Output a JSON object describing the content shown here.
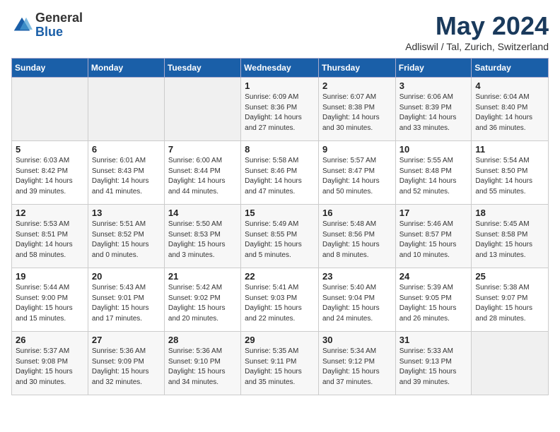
{
  "header": {
    "logo_general": "General",
    "logo_blue": "Blue",
    "title": "May 2024",
    "subtitle": "Adliswil / Tal, Zurich, Switzerland"
  },
  "weekdays": [
    "Sunday",
    "Monday",
    "Tuesday",
    "Wednesday",
    "Thursday",
    "Friday",
    "Saturday"
  ],
  "weeks": [
    [
      {
        "day": "",
        "info": ""
      },
      {
        "day": "",
        "info": ""
      },
      {
        "day": "",
        "info": ""
      },
      {
        "day": "1",
        "info": "Sunrise: 6:09 AM\nSunset: 8:36 PM\nDaylight: 14 hours\nand 27 minutes."
      },
      {
        "day": "2",
        "info": "Sunrise: 6:07 AM\nSunset: 8:38 PM\nDaylight: 14 hours\nand 30 minutes."
      },
      {
        "day": "3",
        "info": "Sunrise: 6:06 AM\nSunset: 8:39 PM\nDaylight: 14 hours\nand 33 minutes."
      },
      {
        "day": "4",
        "info": "Sunrise: 6:04 AM\nSunset: 8:40 PM\nDaylight: 14 hours\nand 36 minutes."
      }
    ],
    [
      {
        "day": "5",
        "info": "Sunrise: 6:03 AM\nSunset: 8:42 PM\nDaylight: 14 hours\nand 39 minutes."
      },
      {
        "day": "6",
        "info": "Sunrise: 6:01 AM\nSunset: 8:43 PM\nDaylight: 14 hours\nand 41 minutes."
      },
      {
        "day": "7",
        "info": "Sunrise: 6:00 AM\nSunset: 8:44 PM\nDaylight: 14 hours\nand 44 minutes."
      },
      {
        "day": "8",
        "info": "Sunrise: 5:58 AM\nSunset: 8:46 PM\nDaylight: 14 hours\nand 47 minutes."
      },
      {
        "day": "9",
        "info": "Sunrise: 5:57 AM\nSunset: 8:47 PM\nDaylight: 14 hours\nand 50 minutes."
      },
      {
        "day": "10",
        "info": "Sunrise: 5:55 AM\nSunset: 8:48 PM\nDaylight: 14 hours\nand 52 minutes."
      },
      {
        "day": "11",
        "info": "Sunrise: 5:54 AM\nSunset: 8:50 PM\nDaylight: 14 hours\nand 55 minutes."
      }
    ],
    [
      {
        "day": "12",
        "info": "Sunrise: 5:53 AM\nSunset: 8:51 PM\nDaylight: 14 hours\nand 58 minutes."
      },
      {
        "day": "13",
        "info": "Sunrise: 5:51 AM\nSunset: 8:52 PM\nDaylight: 15 hours\nand 0 minutes."
      },
      {
        "day": "14",
        "info": "Sunrise: 5:50 AM\nSunset: 8:53 PM\nDaylight: 15 hours\nand 3 minutes."
      },
      {
        "day": "15",
        "info": "Sunrise: 5:49 AM\nSunset: 8:55 PM\nDaylight: 15 hours\nand 5 minutes."
      },
      {
        "day": "16",
        "info": "Sunrise: 5:48 AM\nSunset: 8:56 PM\nDaylight: 15 hours\nand 8 minutes."
      },
      {
        "day": "17",
        "info": "Sunrise: 5:46 AM\nSunset: 8:57 PM\nDaylight: 15 hours\nand 10 minutes."
      },
      {
        "day": "18",
        "info": "Sunrise: 5:45 AM\nSunset: 8:58 PM\nDaylight: 15 hours\nand 13 minutes."
      }
    ],
    [
      {
        "day": "19",
        "info": "Sunrise: 5:44 AM\nSunset: 9:00 PM\nDaylight: 15 hours\nand 15 minutes."
      },
      {
        "day": "20",
        "info": "Sunrise: 5:43 AM\nSunset: 9:01 PM\nDaylight: 15 hours\nand 17 minutes."
      },
      {
        "day": "21",
        "info": "Sunrise: 5:42 AM\nSunset: 9:02 PM\nDaylight: 15 hours\nand 20 minutes."
      },
      {
        "day": "22",
        "info": "Sunrise: 5:41 AM\nSunset: 9:03 PM\nDaylight: 15 hours\nand 22 minutes."
      },
      {
        "day": "23",
        "info": "Sunrise: 5:40 AM\nSunset: 9:04 PM\nDaylight: 15 hours\nand 24 minutes."
      },
      {
        "day": "24",
        "info": "Sunrise: 5:39 AM\nSunset: 9:05 PM\nDaylight: 15 hours\nand 26 minutes."
      },
      {
        "day": "25",
        "info": "Sunrise: 5:38 AM\nSunset: 9:07 PM\nDaylight: 15 hours\nand 28 minutes."
      }
    ],
    [
      {
        "day": "26",
        "info": "Sunrise: 5:37 AM\nSunset: 9:08 PM\nDaylight: 15 hours\nand 30 minutes."
      },
      {
        "day": "27",
        "info": "Sunrise: 5:36 AM\nSunset: 9:09 PM\nDaylight: 15 hours\nand 32 minutes."
      },
      {
        "day": "28",
        "info": "Sunrise: 5:36 AM\nSunset: 9:10 PM\nDaylight: 15 hours\nand 34 minutes."
      },
      {
        "day": "29",
        "info": "Sunrise: 5:35 AM\nSunset: 9:11 PM\nDaylight: 15 hours\nand 35 minutes."
      },
      {
        "day": "30",
        "info": "Sunrise: 5:34 AM\nSunset: 9:12 PM\nDaylight: 15 hours\nand 37 minutes."
      },
      {
        "day": "31",
        "info": "Sunrise: 5:33 AM\nSunset: 9:13 PM\nDaylight: 15 hours\nand 39 minutes."
      },
      {
        "day": "",
        "info": ""
      }
    ]
  ]
}
